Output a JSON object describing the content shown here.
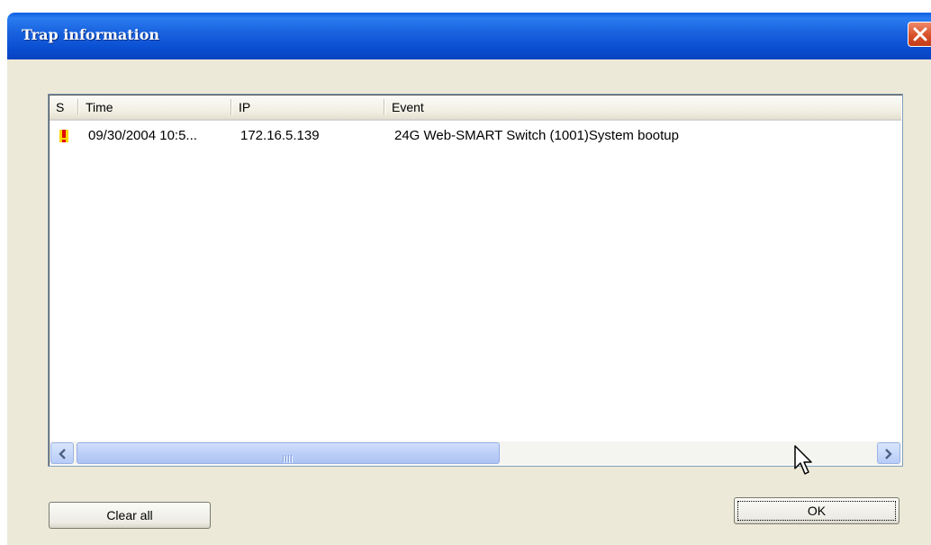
{
  "window": {
    "title": "Trap information"
  },
  "table": {
    "columns": [
      "S",
      "Time",
      "IP",
      "Event"
    ],
    "rows": [
      {
        "severity_icon": "warning-exclamation-icon",
        "time": "09/30/2004 10:5...",
        "ip": "172.16.5.139",
        "event": "24G Web-SMART Switch (1001)System bootup"
      }
    ]
  },
  "buttons": {
    "clear_all": "Clear all",
    "ok": "OK"
  },
  "colors": {
    "titlebar": "#0a4fd2",
    "close": "#d8502a",
    "dialog_bg": "#ece9d8",
    "warning": "#e00000",
    "warning_bg": "#ffd800"
  }
}
